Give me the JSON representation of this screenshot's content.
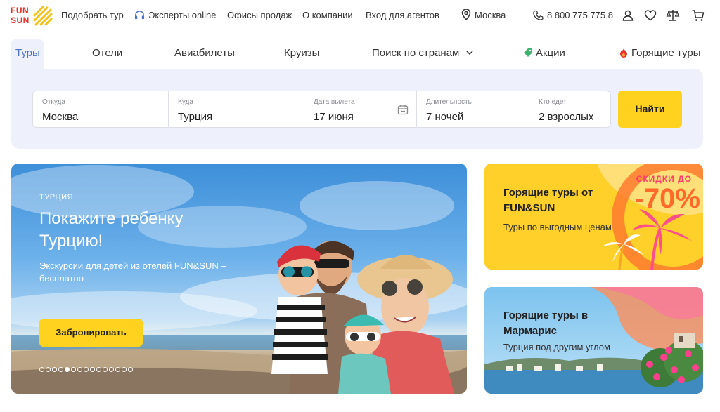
{
  "logo": {
    "line1": "FUN",
    "line2": "SUN"
  },
  "topnav": {
    "links": [
      "Подобрать тур",
      "Эксперты online",
      "Офисы продаж",
      "О компании",
      "Вход для агентов"
    ],
    "city": "Москва",
    "phone": "8 800 775 775 8"
  },
  "tabs": [
    "Туры",
    "Отели",
    "Авиабилеты",
    "Круизы",
    "Поиск по странам",
    "Акции",
    "Горящие туры"
  ],
  "search": {
    "from_label": "Откуда",
    "from_value": "Москва",
    "to_label": "Куда",
    "to_value": "Турция",
    "date_label": "Дата вылета",
    "date_value": "17 июня",
    "duration_label": "Длительность",
    "duration_value": "7 ночей",
    "guests_label": "Кто едет",
    "guests_value": "2 взрослых",
    "submit_label": "Найти"
  },
  "hero": {
    "country": "ТУРЦИЯ",
    "title": "Покажите ребенку Турцию!",
    "subtitle": "Экскурсии для детей из отелей FUN&SUN – бесплатно",
    "button_label": "Забронировать",
    "slides_total": 15,
    "slide_active": 5
  },
  "promo1": {
    "title": "Горящие туры от FUN&SUN",
    "subtitle": "Туры по выгодным ценам",
    "discount_label": "СКИДКИ ДО",
    "discount_value": "-70%"
  },
  "promo2": {
    "title": "Горящие туры в Мармарис",
    "subtitle": "Турция под другим углом"
  },
  "colors": {
    "accent_yellow": "#ffd21f",
    "active_tab_blue": "#4a73c9",
    "panel_bg": "#eef0fb",
    "brand_red": "#e8332a"
  }
}
